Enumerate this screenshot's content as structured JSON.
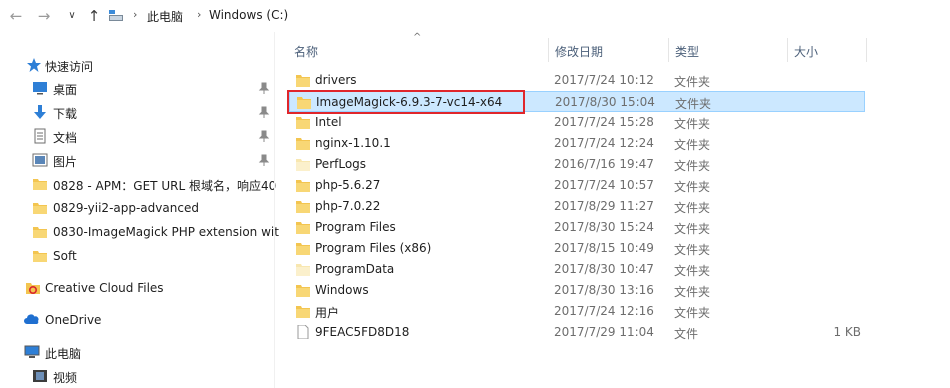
{
  "address": {
    "back_icon": "arrow-left-icon",
    "forward_icon": "arrow-right-icon",
    "recent_icon": "chevron-down-icon",
    "up_icon": "arrow-up-icon",
    "crumbs": [
      "此电脑",
      "Windows (C:)"
    ]
  },
  "sidebar": {
    "quick_access": "快速访问",
    "items": [
      {
        "label": "桌面",
        "icon": "desktop-icon",
        "pinned": true
      },
      {
        "label": "下载",
        "icon": "download-icon",
        "pinned": true
      },
      {
        "label": "文档",
        "icon": "document-icon",
        "pinned": true
      },
      {
        "label": "图片",
        "icon": "picture-icon",
        "pinned": true
      },
      {
        "label": "0828 - APM：GET URL 根域名，响应40",
        "icon": "folder-icon",
        "pinned": false
      },
      {
        "label": "0829-yii2-app-advanced",
        "icon": "folder-icon",
        "pinned": false
      },
      {
        "label": "0830-ImageMagick PHP extension wit",
        "icon": "folder-icon",
        "pinned": false
      },
      {
        "label": "Soft",
        "icon": "folder-icon",
        "pinned": false
      }
    ],
    "creative_cloud": "Creative Cloud Files",
    "onedrive": "OneDrive",
    "this_pc": "此电脑",
    "videos": "视频"
  },
  "columns": {
    "name": "名称",
    "date": "修改日期",
    "type": "类型",
    "size": "大小"
  },
  "files": [
    {
      "name": "drivers",
      "date": "2017/7/24 10:12",
      "type": "文件夹",
      "size": "",
      "kind": "folder"
    },
    {
      "name": "ImageMagick-6.9.3-7-vc14-x64",
      "date": "2017/8/30 15:04",
      "type": "文件夹",
      "size": "",
      "kind": "folder",
      "selected": true
    },
    {
      "name": "Intel",
      "date": "2017/7/24 15:28",
      "type": "文件夹",
      "size": "",
      "kind": "folder"
    },
    {
      "name": "nginx-1.10.1",
      "date": "2017/7/24 12:24",
      "type": "文件夹",
      "size": "",
      "kind": "folder"
    },
    {
      "name": "PerfLogs",
      "date": "2016/7/16 19:47",
      "type": "文件夹",
      "size": "",
      "kind": "folder-light"
    },
    {
      "name": "php-5.6.27",
      "date": "2017/7/24 10:57",
      "type": "文件夹",
      "size": "",
      "kind": "folder"
    },
    {
      "name": "php-7.0.22",
      "date": "2017/8/29 11:27",
      "type": "文件夹",
      "size": "",
      "kind": "folder"
    },
    {
      "name": "Program Files",
      "date": "2017/8/30 15:24",
      "type": "文件夹",
      "size": "",
      "kind": "folder"
    },
    {
      "name": "Program Files (x86)",
      "date": "2017/8/15 10:49",
      "type": "文件夹",
      "size": "",
      "kind": "folder"
    },
    {
      "name": "ProgramData",
      "date": "2017/8/30 10:47",
      "type": "文件夹",
      "size": "",
      "kind": "folder-light"
    },
    {
      "name": "Windows",
      "date": "2017/8/30 13:16",
      "type": "文件夹",
      "size": "",
      "kind": "folder"
    },
    {
      "name": "用户",
      "date": "2017/7/24 12:16",
      "type": "文件夹",
      "size": "",
      "kind": "folder"
    },
    {
      "name": "9FEAC5FD8D18",
      "date": "2017/7/29 11:04",
      "type": "文件",
      "size": "1 KB",
      "kind": "file"
    }
  ],
  "colors": {
    "selection": "#cce8ff",
    "selection_border": "#99d1ff",
    "annotation": "#e0262b",
    "folder": "#f3c550"
  }
}
